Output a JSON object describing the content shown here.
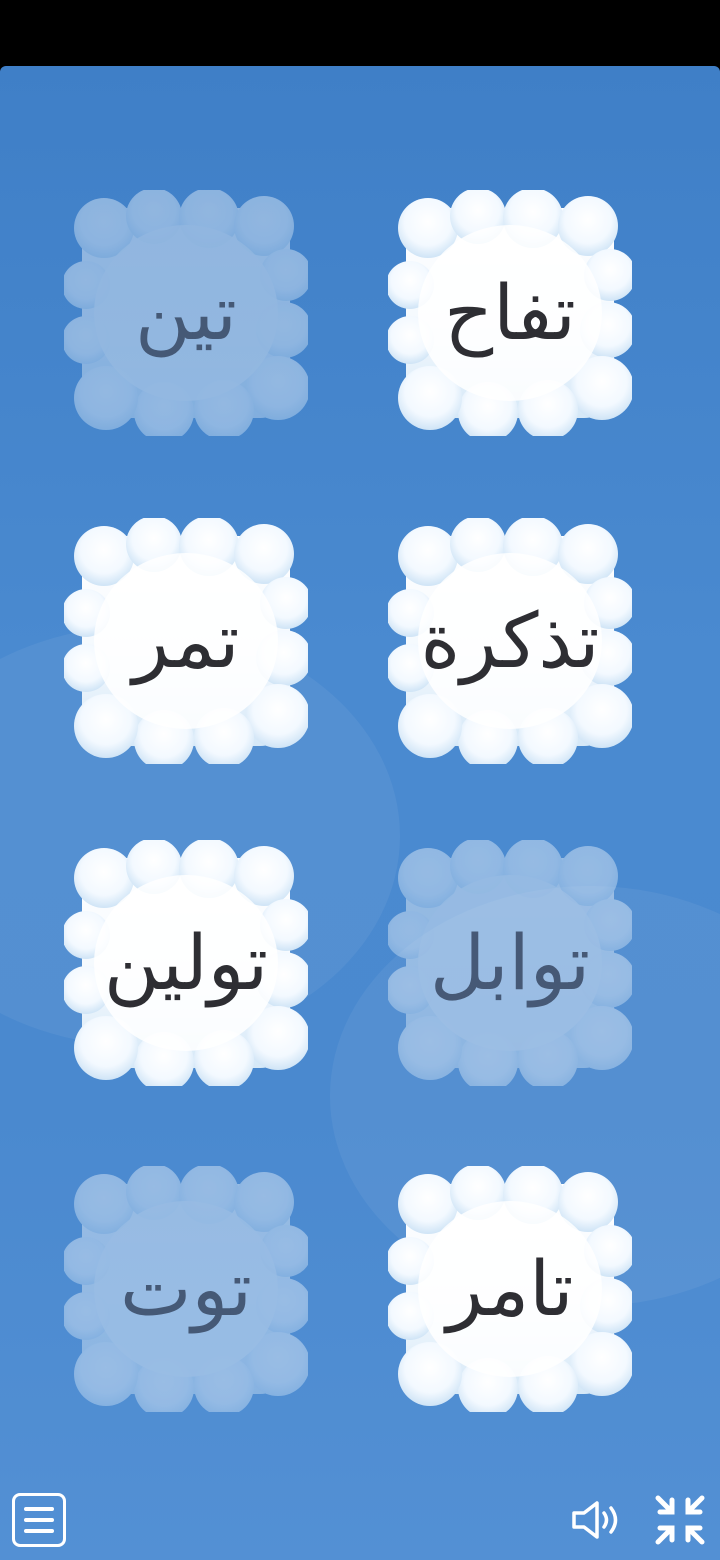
{
  "words": {
    "top_left": "تين",
    "top_right": "تفاح",
    "row2_left": "تمر",
    "row2_right": "تذكرة",
    "row3_left": "تولين",
    "row3_right": "توابل",
    "bottom_left": "توت",
    "bottom_right": "تامر"
  },
  "faded_cards": [
    "تين",
    "توابل",
    "توت"
  ],
  "icons": {
    "menu": "menu-icon",
    "sound": "speaker-icon",
    "collapse": "collapse-fullscreen-icon"
  },
  "colors": {
    "sky": "#4a89cf",
    "word": "#2e2e33",
    "cloud": "#ffffff",
    "cloud_shadow": "#bcd9f2"
  }
}
